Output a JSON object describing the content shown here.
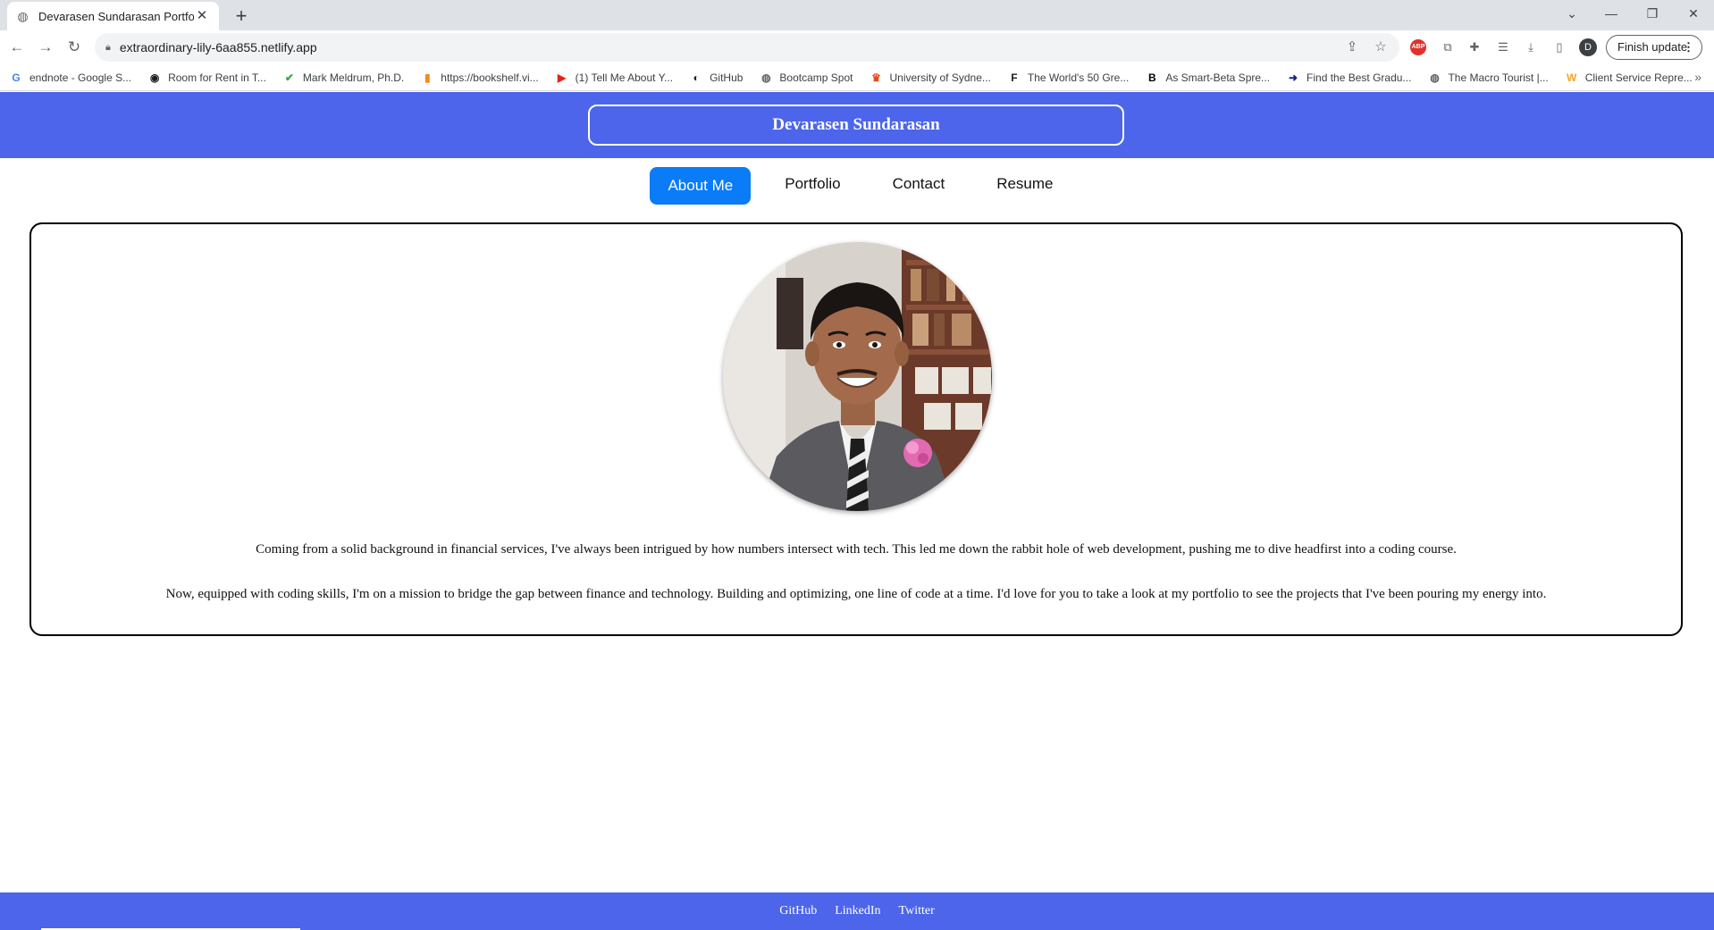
{
  "browser": {
    "tab_title": "Devarasen Sundarasan Portfolio",
    "url": "extraordinary-lily-6aa855.netlify.app",
    "profile_initial": "D",
    "finish_update": "Finish update",
    "bookmarks": [
      {
        "label": "endnote - Google S...",
        "icon": "G",
        "color": "#4285f4"
      },
      {
        "label": "Room for Rent in T...",
        "icon": "◉",
        "color": "#202124"
      },
      {
        "label": "Mark Meldrum, Ph.D.",
        "icon": "✔",
        "color": "#3fa34d"
      },
      {
        "label": "https://bookshelf.vi...",
        "icon": "▮",
        "color": "#f28b1d"
      },
      {
        "label": "(1) Tell Me About Y...",
        "icon": "▶",
        "color": "#e62117"
      },
      {
        "label": "GitHub",
        "icon": "◐",
        "color": "#202124"
      },
      {
        "label": "Bootcamp Spot",
        "icon": "◍",
        "color": "#5f6368"
      },
      {
        "label": "University of Sydne...",
        "icon": "♛",
        "color": "#e64a19"
      },
      {
        "label": "The World's 50 Gre...",
        "icon": "F",
        "color": "#202124"
      },
      {
        "label": "As Smart-Beta Spre...",
        "icon": "B",
        "color": "#000000"
      },
      {
        "label": "Find the Best Gradu...",
        "icon": "➜",
        "color": "#1a237e"
      },
      {
        "label": "The Macro Tourist |...",
        "icon": "◍",
        "color": "#5f6368"
      },
      {
        "label": "Client Service Repre...",
        "icon": "W",
        "color": "#f5a623"
      }
    ]
  },
  "header": {
    "name": "Devarasen Sundarasan"
  },
  "nav": {
    "items": [
      {
        "label": "About Me",
        "active": true
      },
      {
        "label": "Portfolio",
        "active": false
      },
      {
        "label": "Contact",
        "active": false
      },
      {
        "label": "Resume",
        "active": false
      }
    ]
  },
  "about": {
    "paragraph_1": "Coming from a solid background in financial services, I've always been intrigued by how numbers intersect with tech. This led me down the rabbit hole of web development, pushing me to dive headfirst into a coding course.",
    "paragraph_2": "Now, equipped with coding skills, I'm on a mission to bridge the gap between finance and technology. Building and optimizing, one line of code at a time. I'd love for you to take a look at my portfolio to see the projects that I've been pouring my energy into."
  },
  "footer": {
    "links": [
      "GitHub",
      "LinkedIn",
      "Twitter"
    ]
  },
  "colors": {
    "brand_blue": "#4c65ea",
    "active_tab": "#0a7cf7"
  }
}
